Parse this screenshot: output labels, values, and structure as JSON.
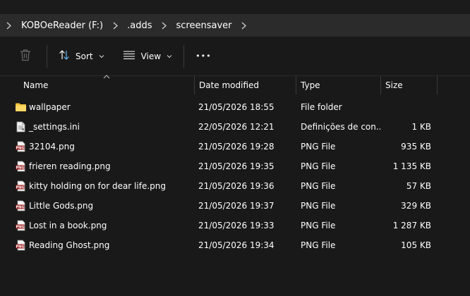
{
  "breadcrumb": [
    "KOBOeReader (F:)",
    ".adds",
    "screensaver"
  ],
  "toolbar": {
    "sort_label": "Sort",
    "view_label": "View",
    "more_label": "•••"
  },
  "columns": {
    "name": "Name",
    "date": "Date modified",
    "type": "Type",
    "size": "Size"
  },
  "files": [
    {
      "name": "wallpaper",
      "date": "21/05/2026 18:55",
      "type": "File folder",
      "size": "",
      "icon": "folder-icon"
    },
    {
      "name": "_settings.ini",
      "date": "22/05/2026 12:21",
      "type": "Definições de con...",
      "size": "1 KB",
      "icon": "ini-file-icon"
    },
    {
      "name": "32104.png",
      "date": "21/05/2026 19:28",
      "type": "PNG File",
      "size": "935 KB",
      "icon": "png-file-icon"
    },
    {
      "name": "frieren reading.png",
      "date": "21/05/2026 19:35",
      "type": "PNG File",
      "size": "1 135 KB",
      "icon": "png-file-icon"
    },
    {
      "name": "kitty holding on for dear life.png",
      "date": "21/05/2026 19:36",
      "type": "PNG File",
      "size": "57 KB",
      "icon": "png-file-icon"
    },
    {
      "name": "Little Gods.png",
      "date": "21/05/2026 19:37",
      "type": "PNG File",
      "size": "329 KB",
      "icon": "png-file-icon"
    },
    {
      "name": "Lost in a book.png",
      "date": "21/05/2026 19:33",
      "type": "PNG File",
      "size": "1 287 KB",
      "icon": "png-file-icon"
    },
    {
      "name": "Reading Ghost.png",
      "date": "21/05/2026 19:34",
      "type": "PNG File",
      "size": "105 KB",
      "icon": "png-file-icon"
    }
  ],
  "colors": {
    "background": "#191919",
    "breadcrumb_bar": "#2b2b2b",
    "folder": "#f4c542"
  }
}
